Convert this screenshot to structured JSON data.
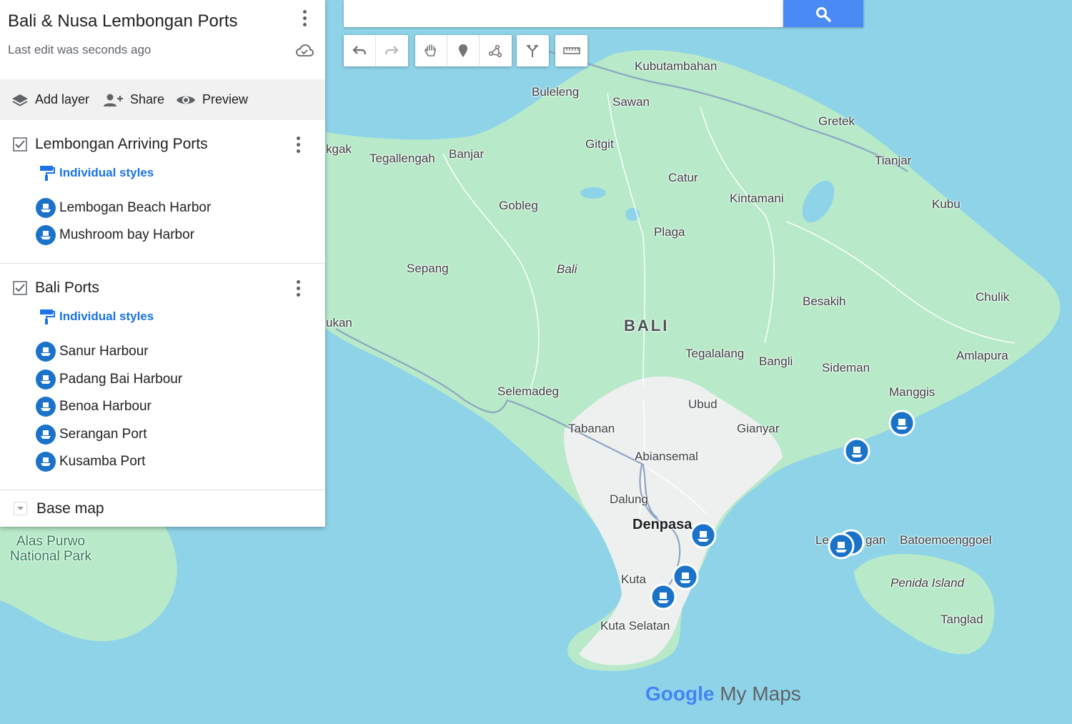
{
  "map": {
    "search_placeholder": "",
    "water_color": "#8fd3e8",
    "land_color": "#b8e9c9",
    "urban_color": "#eef0ef",
    "places": {
      "kubutambahan": "Kubutambahan",
      "buleleng": "Buleleng",
      "sawan": "Sawan",
      "gretek": "Gretek",
      "kgak": "kgak",
      "tegallengah": "Tegallengah",
      "banjar": "Banjar",
      "gitgit": "Gitgit",
      "tianjar": "Tianjar",
      "catur": "Catur",
      "kintamani": "Kintamani",
      "kubu": "Kubu",
      "gobleg": "Gobleg",
      "plaga": "Plaga",
      "sepang": "Sepang",
      "bali_italic": "Bali",
      "chulik": "Chulik",
      "besakih": "Besakih",
      "ukan": "ukan",
      "bali_region": "BALI",
      "tegalalang": "Tegalalang",
      "bangli": "Bangli",
      "amlapura": "Amlapura",
      "sideman": "Sideman",
      "selemadeg": "Selemadeg",
      "manggis": "Manggis",
      "ubud": "Ubud",
      "tabanan": "Tabanan",
      "gianyar": "Gianyar",
      "abiansemal": "Abiansemal",
      "dalung": "Dalung",
      "denpasar": "Denpasa",
      "lembongan_le": "Le",
      "lembongan_gan": "gan",
      "batoemoenggoel": "Batoemoenggoel",
      "alas_purwo": "Alas Purwo\nNational Park",
      "kuta": "Kuta",
      "penida": "Penida Island",
      "tanglad": "Tanglad",
      "kuta_selatan": "Kuta Selatan"
    },
    "logo": {
      "google": "Google",
      "mymaps": " My Maps"
    }
  },
  "panel": {
    "title": "Bali & Nusa Lembongan Ports",
    "subtitle": "Last edit was seconds ago",
    "toolbar": {
      "add_layer": "Add layer",
      "share": "Share",
      "preview": "Preview"
    },
    "layers": [
      {
        "title": "Lembongan Arriving Ports",
        "styles": "Individual styles",
        "items": [
          "Lembogan Beach Harbor",
          "Mushroom bay Harbor"
        ]
      },
      {
        "title": "Bali Ports",
        "styles": "Individual styles",
        "items": [
          "Sanur Harbour",
          "Padang Bai Harbour",
          "Benoa Harbour",
          "Serangan Port",
          "Kusamba Port"
        ]
      }
    ],
    "base_map": "Base map",
    "marker_color": "#1a73c8",
    "link_color": "#1a73e8"
  }
}
